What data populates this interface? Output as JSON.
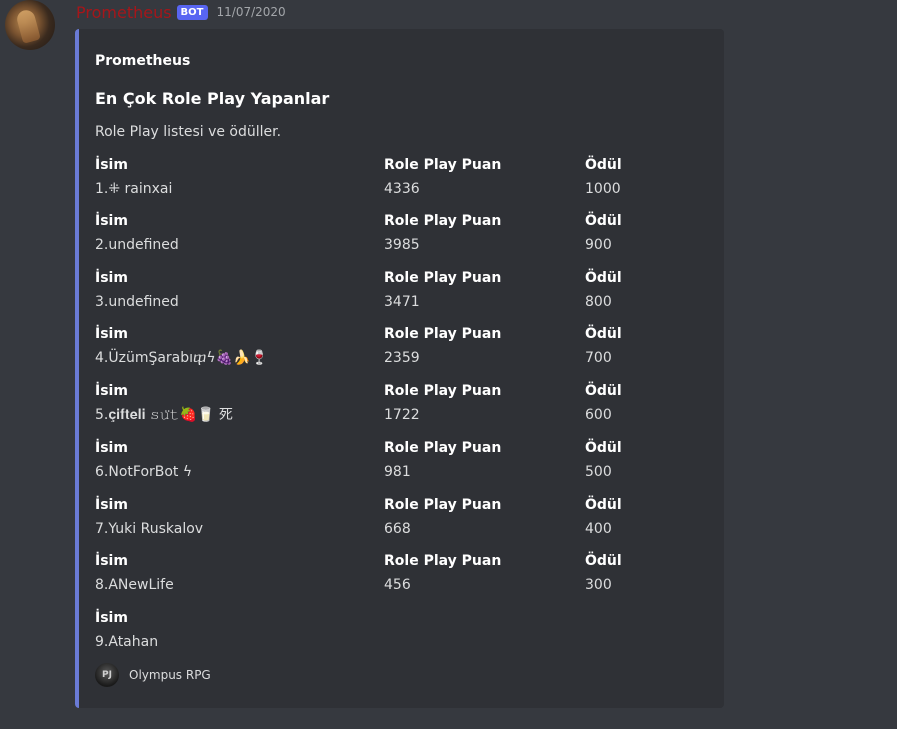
{
  "message": {
    "author": "Prometheus",
    "bot_tag": "BOT",
    "timestamp": "11/07/2020"
  },
  "embed": {
    "accent_color": "#6a7bd6",
    "author_name": "Prometheus",
    "title": "En Çok Role Play Yapanlar",
    "description": "Role Play listesi ve ödüller.",
    "rows": [
      {
        "name_label": "İsim",
        "name": "1.⁜ rainxai",
        "points_label": "Role Play Puan",
        "points": "4336",
        "reward_label": "Ödül",
        "reward": "1000"
      },
      {
        "name_label": "İsim",
        "name": "2.undefined",
        "points_label": "Role Play Puan",
        "points": "3985",
        "reward_label": "Ödül",
        "reward": "900"
      },
      {
        "name_label": "İsim",
        "name": "3.undefined",
        "points_label": "Role Play Puan",
        "points": "3471",
        "reward_label": "Ödül",
        "reward": "800"
      },
      {
        "name_label": "İsim",
        "name": "4.ÜzümŞarabıⴔϟ🍇🍌🍷",
        "points_label": "Role Play Puan",
        "points": "2359",
        "reward_label": "Ödül",
        "reward": "700"
      },
      {
        "name_label": "İsim",
        "name": "5.𝐜̧𝐢𝐟𝐭𝐞𝐥𝐢 𝚜𝚞̈𝚝🍓🥛 死",
        "points_label": "Role Play Puan",
        "points": "1722",
        "reward_label": "Ödül",
        "reward": "600"
      },
      {
        "name_label": "İsim",
        "name": "6.NotForBot ϟ",
        "points_label": "Role Play Puan",
        "points": "981",
        "reward_label": "Ödül",
        "reward": "500"
      },
      {
        "name_label": "İsim",
        "name": "7.Yuki Ruskalov",
        "points_label": "Role Play Puan",
        "points": "668",
        "reward_label": "Ödül",
        "reward": "400"
      },
      {
        "name_label": "İsim",
        "name": "8.ANewLife",
        "points_label": "Role Play Puan",
        "points": "456",
        "reward_label": "Ödül",
        "reward": "300"
      },
      {
        "name_label": "İsim",
        "name": "9.Atahan"
      }
    ],
    "footer": {
      "icon_text": "PJ",
      "text": "Olympus RPG"
    }
  }
}
